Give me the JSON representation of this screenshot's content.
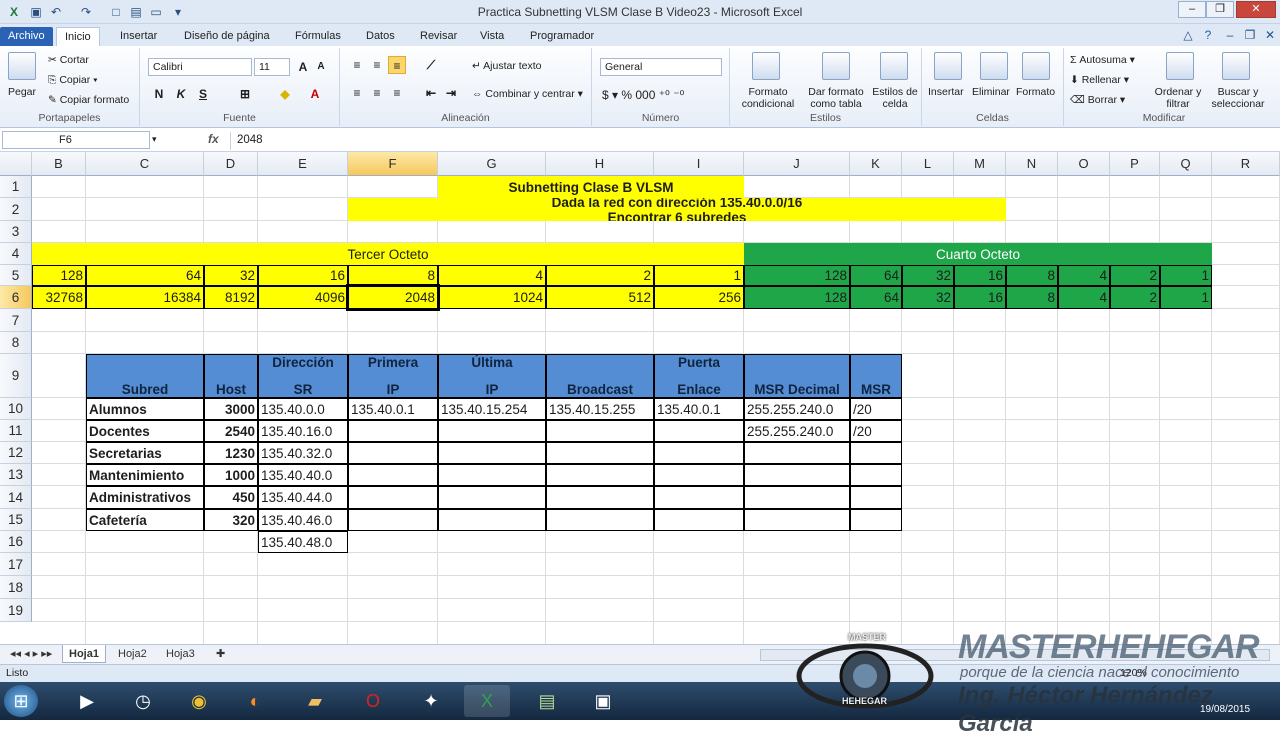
{
  "window": {
    "title": "Practica Subnetting VLSM Clase B Video23 - Microsoft Excel",
    "minimize": "–",
    "restore": "❐",
    "close": "✕"
  },
  "tabs": [
    "Archivo",
    "Inicio",
    "Insertar",
    "Diseño de página",
    "Fórmulas",
    "Datos",
    "Revisar",
    "Vista",
    "Programador"
  ],
  "ribbon": {
    "clipboard": {
      "paste": "Pegar",
      "cut": "Cortar",
      "copy": "Copiar",
      "format_painter": "Copiar formato",
      "label": "Portapapeles"
    },
    "font": {
      "name": "Calibri",
      "size": "11",
      "bold": "N",
      "italic": "K",
      "underline": "S",
      "label": "Fuente"
    },
    "alignment": {
      "wrap": "Ajustar texto",
      "merge": "Combinar y centrar",
      "label": "Alineación"
    },
    "number": {
      "format": "General",
      "label": "Número"
    },
    "styles": {
      "cond": "Formato condicional",
      "table": "Dar formato como tabla",
      "cell_styles": "Estilos de celda",
      "label": "Estilos"
    },
    "cells": {
      "insert": "Insertar",
      "delete": "Eliminar",
      "format": "Formato",
      "label": "Celdas"
    },
    "editing": {
      "autosum": "Autosuma",
      "fill": "Rellenar",
      "clear": "Borrar",
      "sort": "Ordenar y filtrar",
      "find": "Buscar y seleccionar",
      "label": "Modificar"
    }
  },
  "formula_bar": {
    "name_box": "F6",
    "fx": "fx",
    "value": "2048"
  },
  "columns": [
    "B",
    "C",
    "D",
    "E",
    "F",
    "G",
    "H",
    "I",
    "J",
    "K",
    "L",
    "M",
    "N",
    "O",
    "P",
    "Q",
    "R"
  ],
  "rows": [
    "1",
    "2",
    "3",
    "4",
    "5",
    "6",
    "7",
    "8",
    "9",
    "10",
    "11",
    "12",
    "13",
    "14",
    "15",
    "16",
    "17",
    "18",
    "19"
  ],
  "header": {
    "title": "Subnetting Clase B VLSM",
    "line2": "Dada la red con dirección 135.40.0.0/16",
    "line3": "Encontrar 6 subredes"
  },
  "octets": {
    "third": "Tercer Octeto",
    "fourth": "Cuarto Octeto"
  },
  "row5": [
    "128",
    "64",
    "32",
    "16",
    "8",
    "4",
    "2",
    "1",
    "128",
    "64",
    "32",
    "16",
    "8",
    "4",
    "2",
    "1"
  ],
  "row6": [
    "32768",
    "16384",
    "8192",
    "4096",
    "2048",
    "1024",
    "512",
    "256",
    "128",
    "64",
    "32",
    "16",
    "8",
    "4",
    "2",
    "1"
  ],
  "table": {
    "headers": {
      "subred": "Subred",
      "host": "Host",
      "dir1": "Dirección",
      "dir2": "SR",
      "pri1": "Primera",
      "pri2": "IP",
      "ult1": "Última",
      "ult2": "IP",
      "broadcast": "Broadcast",
      "pe1": "Puerta",
      "pe2": "Enlace",
      "msrd": "MSR Decimal",
      "msr": "MSR"
    },
    "rows": [
      {
        "subred": "Alumnos",
        "host": "3000",
        "dir": "135.40.0.0",
        "primera": "135.40.0.1",
        "ultima": "135.40.15.254",
        "broadcast": "135.40.15.255",
        "puerta": "135.40.0.1",
        "msrd": "255.255.240.0",
        "msr": "/20"
      },
      {
        "subred": "Docentes",
        "host": "2540",
        "dir": "135.40.16.0",
        "primera": "",
        "ultima": "",
        "broadcast": "",
        "puerta": "",
        "msrd": "255.255.240.0",
        "msr": "/20"
      },
      {
        "subred": "Secretarias",
        "host": "1230",
        "dir": "135.40.32.0",
        "primera": "",
        "ultima": "",
        "broadcast": "",
        "puerta": "",
        "msrd": "",
        "msr": ""
      },
      {
        "subred": "Mantenimiento",
        "host": "1000",
        "dir": "135.40.40.0",
        "primera": "",
        "ultima": "",
        "broadcast": "",
        "puerta": "",
        "msrd": "",
        "msr": ""
      },
      {
        "subred": "Administrativos",
        "host": "450",
        "dir": "135.40.44.0",
        "primera": "",
        "ultima": "",
        "broadcast": "",
        "puerta": "",
        "msrd": "",
        "msr": ""
      },
      {
        "subred": "Cafetería",
        "host": "320",
        "dir": "135.40.46.0",
        "primera": "",
        "ultima": "",
        "broadcast": "",
        "puerta": "",
        "msrd": "",
        "msr": ""
      }
    ],
    "extra_dir": "135.40.48.0"
  },
  "sheet_tabs": [
    "Hoja1",
    "Hoja2",
    "Hoja3"
  ],
  "status": {
    "ready": "Listo",
    "zoom": "120%"
  },
  "watermark": {
    "brand": "MASTERHEHEGAR",
    "tagline": "porque de la ciencia nace el conocimiento",
    "author": "Ing. Héctor Hernández García",
    "logo_top": "MASTER",
    "logo_bottom": "HEHEGAR"
  },
  "clock": {
    "date": "19/08/2015"
  },
  "colors": {
    "yellow": "#ffff00",
    "green": "#1fa649",
    "blue": "#548dd4",
    "excel_tab": "#2a62b6"
  }
}
